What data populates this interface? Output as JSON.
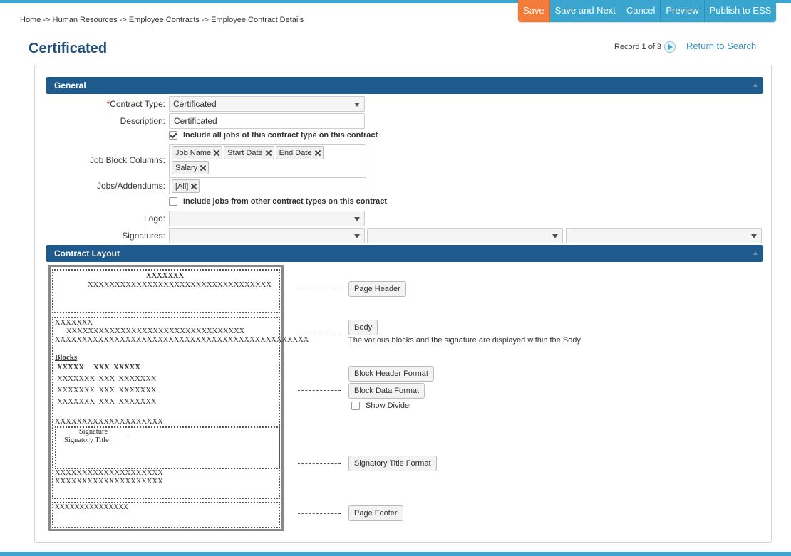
{
  "breadcrumb": "Home -> Human Resources -> Employee Contracts -> Employee Contract Details",
  "toolbar": {
    "save": "Save",
    "save_next": "Save and Next",
    "cancel": "Cancel",
    "preview": "Preview",
    "publish": "Publish to ESS"
  },
  "page_title": "Certificated",
  "record_nav": "Record 1 of 3",
  "return_link": "Return to Search",
  "general": {
    "header": "General",
    "contract_type_req": "*",
    "contract_type_label": "Contract Type:",
    "contract_type_value": "Certificated",
    "description_label": "Description:",
    "description_value": "Certificated",
    "include_all_jobs": "Include all jobs of this contract type on this contract",
    "job_block_columns_label": "Job Block Columns:",
    "job_block_columns": [
      "Job Name",
      "Start Date",
      "End Date",
      "Salary"
    ],
    "jobs_addendums_label": "Jobs/Addendums:",
    "jobs_addendums": [
      "[All]"
    ],
    "include_other_jobs": "Include jobs from other contract types on this contract",
    "logo_label": "Logo:",
    "signatures_label": "Signatures:"
  },
  "layout": {
    "header": "Contract Layout",
    "preview": {
      "ph_title": "XXXXXXX",
      "ph_line": "XXXXXXXXXXXXXXXXXXXXXXXXXXXXXXXXXX",
      "body_l1": "XXXXXXX",
      "body_l2": "XXXXXXXXXXXXXXXXXXXXXXXXXXXXXXXXX",
      "body_l3": "XXXXXXXXXXXXXXXXXXXXXXXXXXXXXXXXXXXXXXXXXXXXXXX",
      "blocks": "Blocks",
      "blk_head": "XXXXX     XXX  XXXXX",
      "blk_row1": "XXXXXXX  XXX  XXXXXXX",
      "blk_row2": "XXXXXXX  XXX  XXXXXXX",
      "blk_row3": "XXXXXXX  XXX  XXXXXXX",
      "after_blocks": "XXXXXXXXXXXXXXXXXXXX",
      "signature": "Signature",
      "signatory_title": "Signatory Title",
      "after_sig1": "XXXXXXXXXXXXXXXXXXXX",
      "after_sig2": "XXXXXXXXXXXXXXXXXXXX",
      "footer": "XXXXXXXXXXXXXXX"
    },
    "page_header_btn": "Page Header",
    "body_btn": "Body",
    "body_note": "The various blocks and the signature are displayed within the Body",
    "block_header_btn": "Block Header Format",
    "block_data_btn": "Block Data Format",
    "show_divider": "Show Divider",
    "signatory_btn": "Signatory Title Format",
    "page_footer_btn": "Page Footer"
  }
}
